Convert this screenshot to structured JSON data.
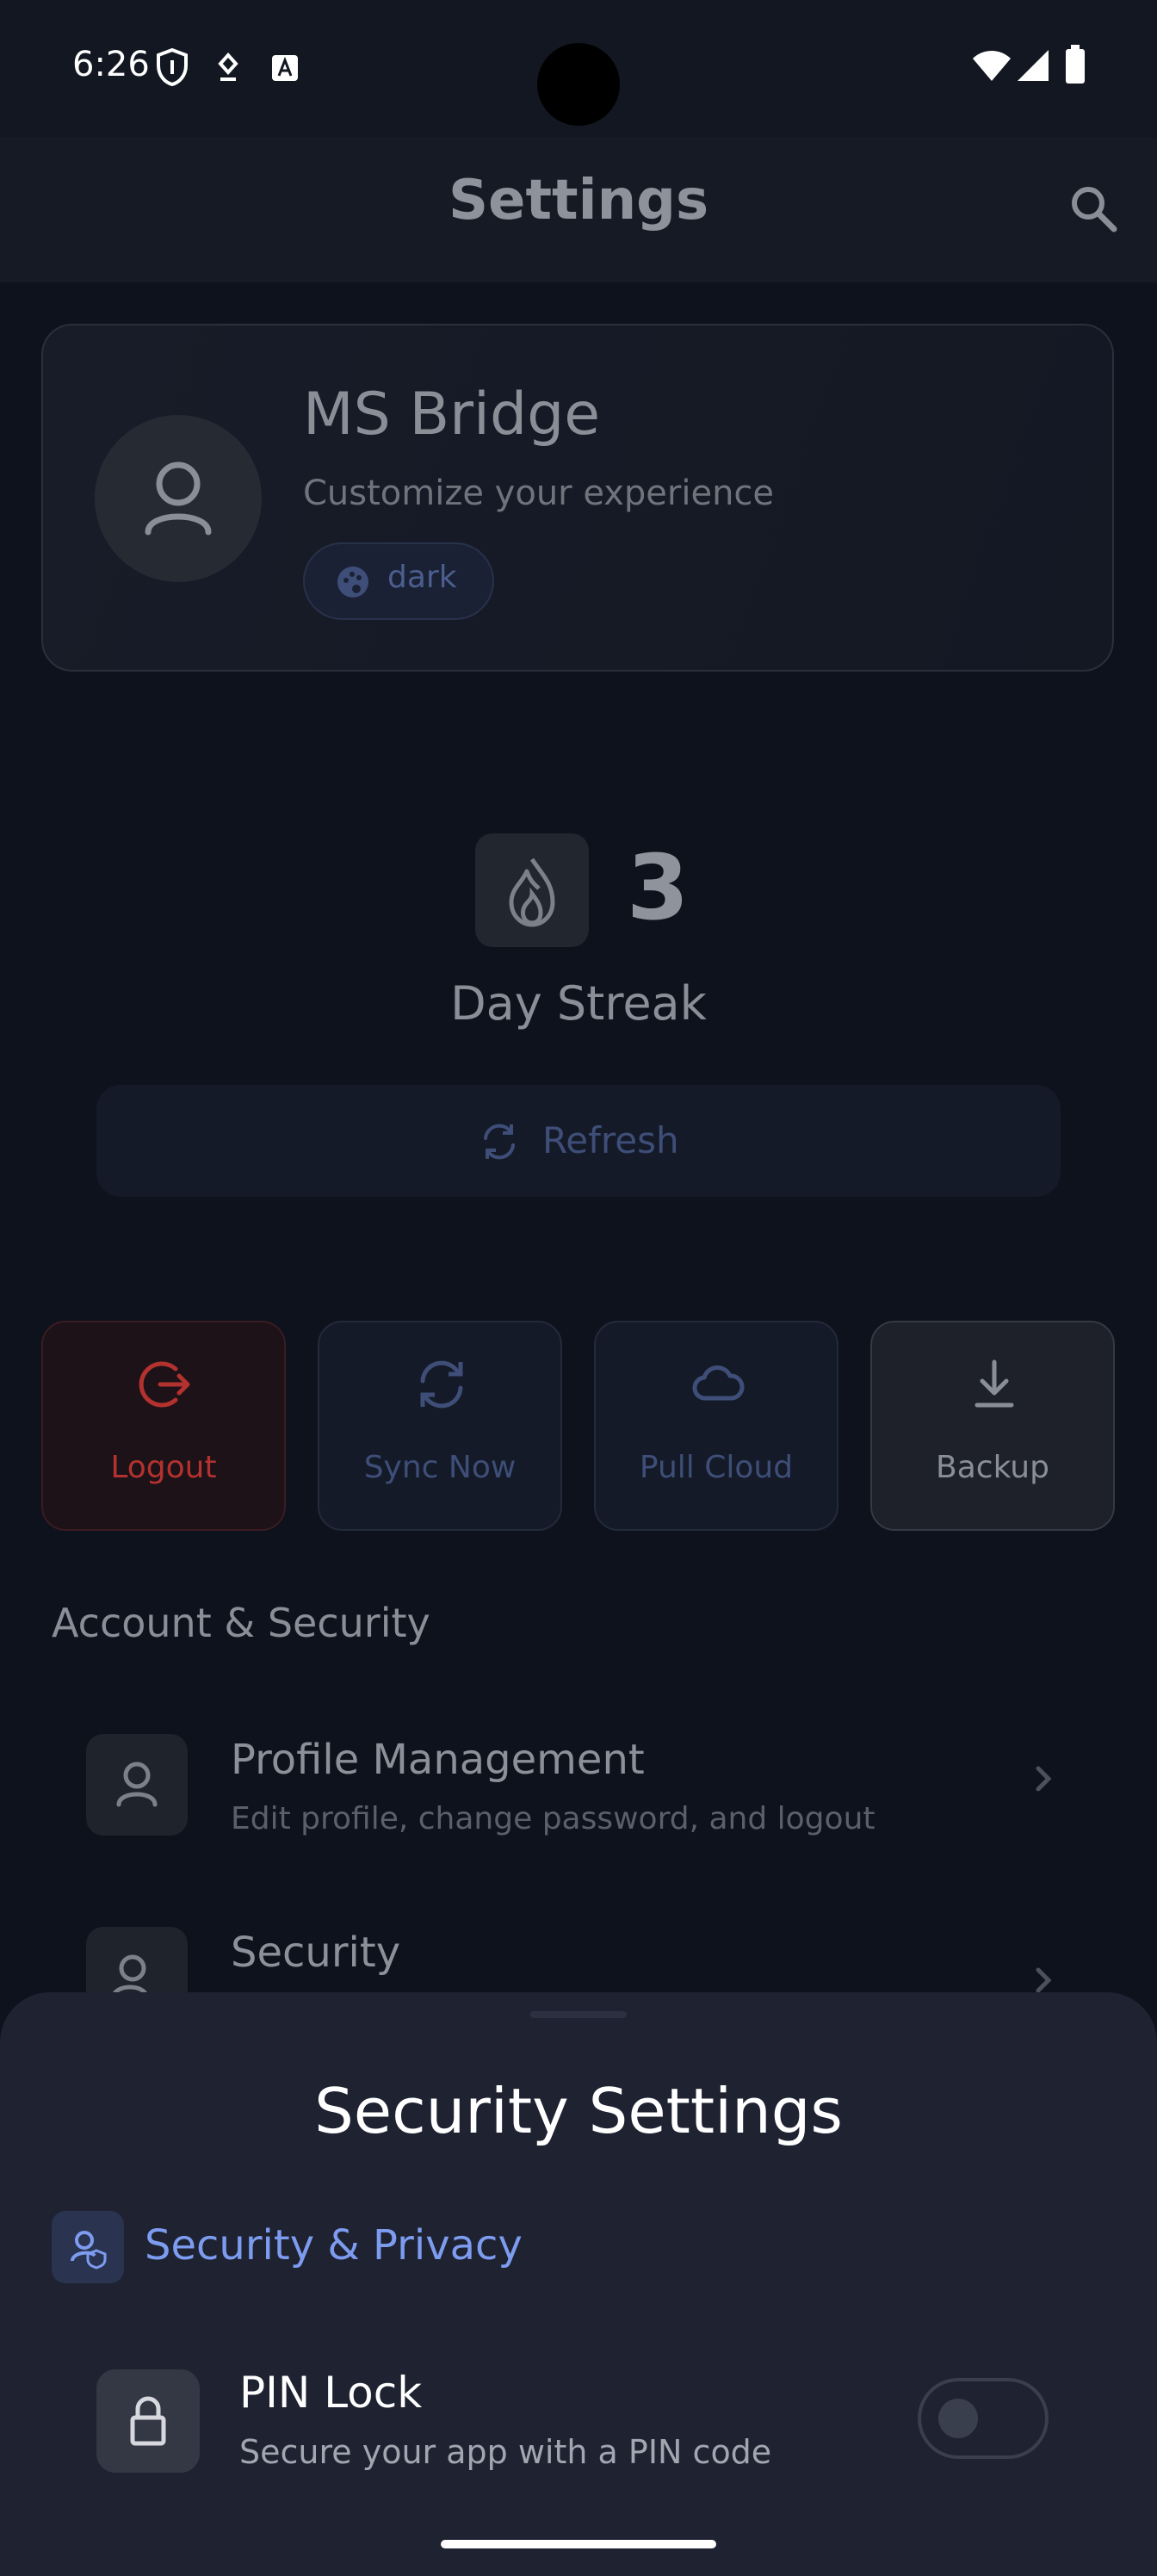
{
  "status_bar": {
    "time": "6:26"
  },
  "header": {
    "title": "Settings",
    "search_icon": "search-icon"
  },
  "profile_card": {
    "name": "MS Bridge",
    "subtitle": "Customize your experience",
    "theme_chip": "dark"
  },
  "streak": {
    "count": "3",
    "label": "Day Streak",
    "refresh_label": "Refresh"
  },
  "actions": [
    {
      "label": "Logout",
      "icon": "logout-icon",
      "color": "#b3322f"
    },
    {
      "label": "Sync Now",
      "icon": "sync-icon",
      "color": "#3e4e78"
    },
    {
      "label": "Pull Cloud",
      "icon": "cloud-icon",
      "color": "#3e4e78"
    },
    {
      "label": "Backup",
      "icon": "download-icon",
      "color": "#8a8e96"
    }
  ],
  "account_section": {
    "title": "Account & Security",
    "items": [
      {
        "title": "Profile Management",
        "subtitle": "Edit profile, change password, and logout"
      },
      {
        "title": "Security",
        "subtitle": ""
      }
    ]
  },
  "security_sheet": {
    "title": "Security Settings",
    "section_label": "Security & Privacy",
    "pin_lock": {
      "title": "PIN Lock",
      "subtitle": "Secure your app with a PIN code",
      "enabled": false
    }
  },
  "colors": {
    "accent": "#7d9cf0",
    "logout": "#b3322f",
    "background": "#0e121c",
    "sheet": "#1e2231"
  }
}
